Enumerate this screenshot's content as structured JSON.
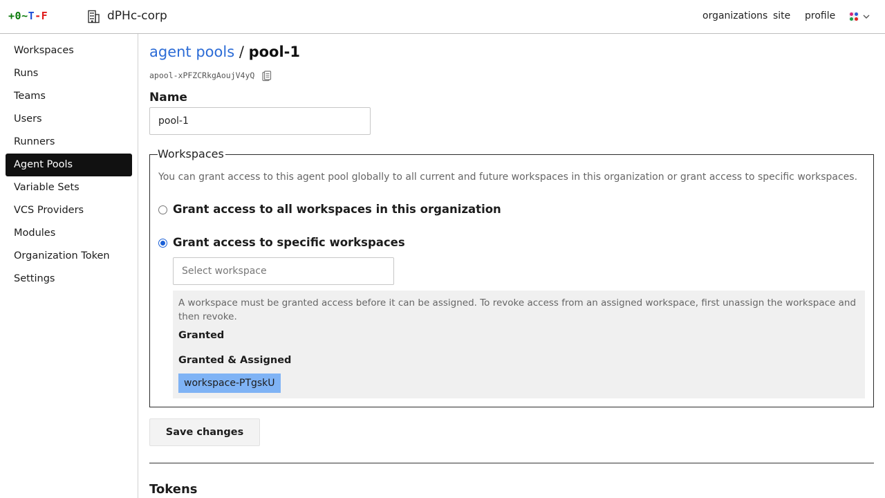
{
  "header": {
    "logo_parts": [
      "+0",
      "~",
      "T",
      "-F"
    ],
    "org_name": "dPHc-corp",
    "nav": {
      "organizations": "organizations",
      "site": "site",
      "profile": "profile"
    },
    "org_icon": "building-icon",
    "menu_icon": "color-dots-icon",
    "menu_chevron": "chevron-down-icon",
    "dot_colors": [
      "#d6247a",
      "#2a5bd7",
      "#1aa34a",
      "#e02323"
    ]
  },
  "sidebar": {
    "items": [
      {
        "label": "Workspaces",
        "active": false
      },
      {
        "label": "Runs",
        "active": false
      },
      {
        "label": "Teams",
        "active": false
      },
      {
        "label": "Users",
        "active": false
      },
      {
        "label": "Runners",
        "active": false
      },
      {
        "label": "Agent Pools",
        "active": true
      },
      {
        "label": "Variable Sets",
        "active": false
      },
      {
        "label": "VCS Providers",
        "active": false
      },
      {
        "label": "Modules",
        "active": false
      },
      {
        "label": "Organization Token",
        "active": false
      },
      {
        "label": "Settings",
        "active": false
      }
    ]
  },
  "breadcrumb": {
    "parent": "agent pools",
    "separator": "/",
    "current": "pool-1"
  },
  "pool": {
    "id": "apool-xPFZCRkgAoujV4yQ",
    "copy_icon": "copy-icon"
  },
  "name_field": {
    "label": "Name",
    "value": "pool-1"
  },
  "workspaces": {
    "legend": "Workspaces",
    "description": "You can grant access to this agent pool globally to all current and future workspaces in this organization or grant access to specific workspaces.",
    "option_all": {
      "label": "Grant access to all workspaces in this organization",
      "checked": false
    },
    "option_specific": {
      "label": "Grant access to specific workspaces",
      "checked": true
    },
    "select_placeholder": "Select workspace",
    "info": "A workspace must be granted access before it can be assigned. To revoke access from an assigned workspace, first unassign the workspace and then revoke.",
    "granted_heading": "Granted",
    "granted_assigned_heading": "Granted & Assigned",
    "granted_assigned": [
      "workspace-PTgskU"
    ]
  },
  "actions": {
    "save_label": "Save changes"
  },
  "tokens": {
    "heading": "Tokens"
  },
  "colors": {
    "accent": "#2b6bd6",
    "chip": "#7fb3f5",
    "active_nav": "#111111"
  }
}
